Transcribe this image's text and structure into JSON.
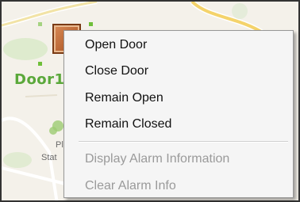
{
  "map": {
    "door_label": "Door1",
    "poi_text": [
      "Pl",
      "Stat"
    ]
  },
  "context_menu": {
    "items": [
      {
        "label": "Open Door",
        "enabled": true
      },
      {
        "label": "Close Door",
        "enabled": true
      },
      {
        "label": "Remain Open",
        "enabled": true
      },
      {
        "label": "Remain Closed",
        "enabled": true
      },
      {
        "label": "Display Alarm Information",
        "enabled": false
      },
      {
        "label": "Clear Alarm Info",
        "enabled": false
      }
    ]
  },
  "colors": {
    "door_label": "#5aa83a",
    "selection_handle": "#6fbf3a",
    "door_icon": "#b85a28",
    "disabled_text": "#9a9a9a"
  }
}
